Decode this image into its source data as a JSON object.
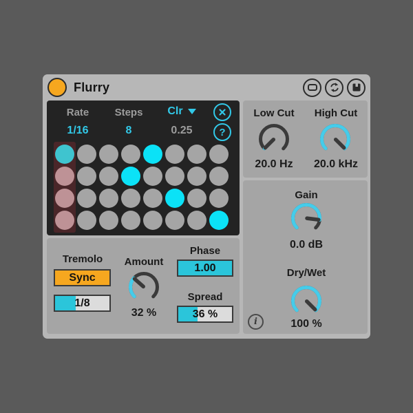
{
  "device": {
    "title": "Flurry",
    "titlebar_icons": [
      "banks-icon",
      "hotswap-icon",
      "save-icon"
    ]
  },
  "sequencer": {
    "rate_label": "Rate",
    "rate_value": "1/16",
    "steps_label": "Steps",
    "steps_value": "8",
    "clear_label": "Clr",
    "jitter_value": "0.25",
    "close_glyph": "X",
    "help_glyph": "?",
    "grid": {
      "rows": 4,
      "cols": 8,
      "active_cells": [
        [
          0,
          0
        ],
        [
          0,
          4
        ],
        [
          1,
          3
        ],
        [
          2,
          5
        ],
        [
          3,
          7
        ]
      ],
      "playhead_col": 0
    }
  },
  "tremolo": {
    "section_label": "Tremolo",
    "sync_button": "Sync",
    "sync_rate_value": "1/8",
    "sync_rate_fill": 38,
    "amount_label": "Amount",
    "amount_value": "32 %",
    "amount_percent": 32,
    "phase_label": "Phase",
    "phase_value": "1.00",
    "phase_fill": 100,
    "spread_label": "Spread",
    "spread_value": "36 %",
    "spread_fill": 36
  },
  "filter": {
    "low_cut_label": "Low Cut",
    "low_cut_value": "20.0 Hz",
    "low_cut_percent": 0,
    "high_cut_label": "High Cut",
    "high_cut_value": "20.0 kHz",
    "high_cut_percent": 100
  },
  "output": {
    "gain_label": "Gain",
    "gain_value": "0.0 dB",
    "gain_percent": 86,
    "dry_wet_label": "Dry/Wet",
    "dry_wet_value": "100 %",
    "dry_wet_percent": 100,
    "info_glyph": "i"
  },
  "colors": {
    "accent_cyan": "#32C9E8",
    "dot_active_cyan": "#0BE2F7",
    "box_fill_cyan": "#2BC5DA",
    "knob_arc_cyan": "#45CCEA",
    "orange": "#F6A71F",
    "playhead_red": "#4A2629",
    "panel_dark": "#232323",
    "panel_gray": "#A5A5A5",
    "device_gray": "#B7B7B7"
  }
}
